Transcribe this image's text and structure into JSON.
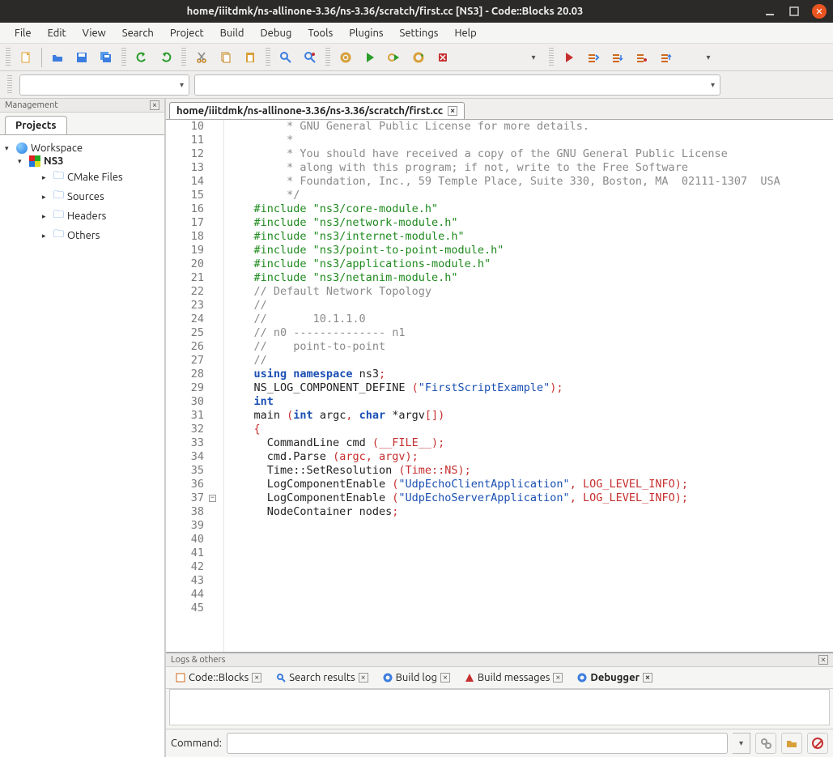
{
  "window": {
    "title": "home/iiitdmk/ns-allinone-3.36/ns-3.36/scratch/first.cc [NS3] - Code::Blocks 20.03"
  },
  "menu": [
    "File",
    "Edit",
    "View",
    "Search",
    "Project",
    "Build",
    "Debug",
    "Tools",
    "Plugins",
    "Settings",
    "Help"
  ],
  "management": {
    "title": "Management",
    "tab": "Projects"
  },
  "tree": {
    "root": "Workspace",
    "project": "NS3",
    "folders": [
      "CMake Files",
      "Sources",
      "Headers",
      "Others"
    ]
  },
  "editor": {
    "tab_title": "home/iiitdmk/ns-allinone-3.36/ns-3.36/scratch/first.cc",
    "first_line": 10,
    "lines": [
      {
        "t": "comment",
        "s": "     * GNU General Public License for more details."
      },
      {
        "t": "comment",
        "s": "     *"
      },
      {
        "t": "comment",
        "s": "     * You should have received a copy of the GNU General Public License"
      },
      {
        "t": "comment",
        "s": "     * along with this program; if not, write to the Free Software"
      },
      {
        "t": "comment",
        "s": "     * Foundation, Inc., 59 Temple Place, Suite 330, Boston, MA  02111-1307  USA"
      },
      {
        "t": "comment",
        "s": "     */"
      },
      {
        "t": "blank",
        "s": ""
      },
      {
        "t": "pp",
        "s": "#include \"ns3/core-module.h\""
      },
      {
        "t": "pp",
        "s": "#include \"ns3/network-module.h\""
      },
      {
        "t": "pp",
        "s": "#include \"ns3/internet-module.h\""
      },
      {
        "t": "pp",
        "s": "#include \"ns3/point-to-point-module.h\""
      },
      {
        "t": "pp",
        "s": "#include \"ns3/applications-module.h\""
      },
      {
        "t": "pp",
        "s": "#include \"ns3/netanim-module.h\""
      },
      {
        "t": "blank",
        "s": ""
      },
      {
        "t": "linecomment",
        "s": "// Default Network Topology"
      },
      {
        "t": "linecomment",
        "s": "//"
      },
      {
        "t": "linecomment",
        "s": "//       10.1.1.0"
      },
      {
        "t": "linecomment",
        "s": "// n0 -------------- n1"
      },
      {
        "t": "linecomment",
        "s": "//    point-to-point"
      },
      {
        "t": "linecomment",
        "s": "//"
      },
      {
        "t": "blank",
        "s": ""
      },
      {
        "t": "using",
        "kw1": "using",
        "kw2": "namespace",
        "id": "ns3",
        "sc": ";"
      },
      {
        "t": "blank",
        "s": ""
      },
      {
        "t": "call",
        "id": "NS_LOG_COMPONENT_DEFINE ",
        "p1": "(",
        "str": "\"FirstScriptExample\"",
        "p2": ");"
      },
      {
        "t": "blank",
        "s": ""
      },
      {
        "t": "kwline",
        "kw": "int"
      },
      {
        "t": "mainsig",
        "id1": "main ",
        "p1": "(",
        "kw1": "int",
        "id2": " argc",
        "p2": ", ",
        "kw2": "char",
        "id3": " *argv",
        "p3": "[])"
      },
      {
        "t": "brace",
        "s": "{"
      },
      {
        "t": "stmt",
        "indent": "  ",
        "id": "CommandLine cmd ",
        "p": "(__FILE__);"
      },
      {
        "t": "stmt",
        "indent": "  ",
        "id": "cmd.Parse ",
        "p": "(argc, argv);"
      },
      {
        "t": "blank",
        "s": ""
      },
      {
        "t": "stmt",
        "indent": "  ",
        "id": "Time::SetResolution ",
        "p": "(Time::NS);"
      },
      {
        "t": "log",
        "indent": "  ",
        "id": "LogComponentEnable ",
        "p1": "(",
        "str": "\"UdpEchoClientApplication\"",
        "p2": ", LOG_LEVEL_INFO);"
      },
      {
        "t": "log",
        "indent": "  ",
        "id": "LogComponentEnable ",
        "p1": "(",
        "str": "\"UdpEchoServerApplication\"",
        "p2": ", LOG_LEVEL_INFO);"
      },
      {
        "t": "blank",
        "s": ""
      },
      {
        "t": "stmt",
        "indent": "  ",
        "id": "NodeContainer nodes",
        "p": ";"
      }
    ]
  },
  "logs": {
    "header": "Logs & others",
    "tabs": [
      "Code::Blocks",
      "Search results",
      "Build log",
      "Build messages",
      "Debugger"
    ],
    "active": 4,
    "command_label": "Command:"
  }
}
